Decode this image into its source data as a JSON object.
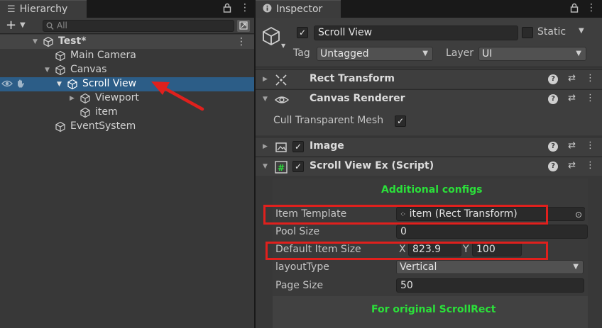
{
  "hierarchy": {
    "tab_label": "Hierarchy",
    "search_placeholder": "All",
    "scene_name": "Test*",
    "items": [
      {
        "label": "Main Camera"
      },
      {
        "label": "Canvas"
      },
      {
        "label": "Scroll View"
      },
      {
        "label": "Viewport"
      },
      {
        "label": "item"
      },
      {
        "label": "EventSystem"
      }
    ]
  },
  "inspector": {
    "tab_label": "Inspector",
    "object_name": "Scroll View",
    "static_label": "Static",
    "tag_label": "Tag",
    "tag_value": "Untagged",
    "layer_label": "Layer",
    "layer_value": "UI",
    "components": {
      "rect_transform": "Rect Transform",
      "canvas_renderer": "Canvas Renderer",
      "cull_label": "Cull Transparent Mesh",
      "image": "Image",
      "script": "Scroll View Ex (Script)"
    },
    "script_props": {
      "additional_configs": "Additional configs",
      "item_template_label": "Item Template",
      "item_template_value": "item (Rect Transform)",
      "pool_size_label": "Pool Size",
      "pool_size_value": "0",
      "default_item_size_label": "Default Item Size",
      "x_label": "X",
      "x_value": "823.9",
      "y_label": "Y",
      "y_value": "100",
      "layout_type_label": "layoutType",
      "layout_type_value": "Vertical",
      "page_size_label": "Page Size",
      "page_size_value": "50",
      "original_scrollrect": "For original ScrollRect"
    }
  },
  "colors": {
    "selection": "#2c5d87",
    "annotation_red": "#e0201d",
    "section_green": "#2be03a"
  }
}
